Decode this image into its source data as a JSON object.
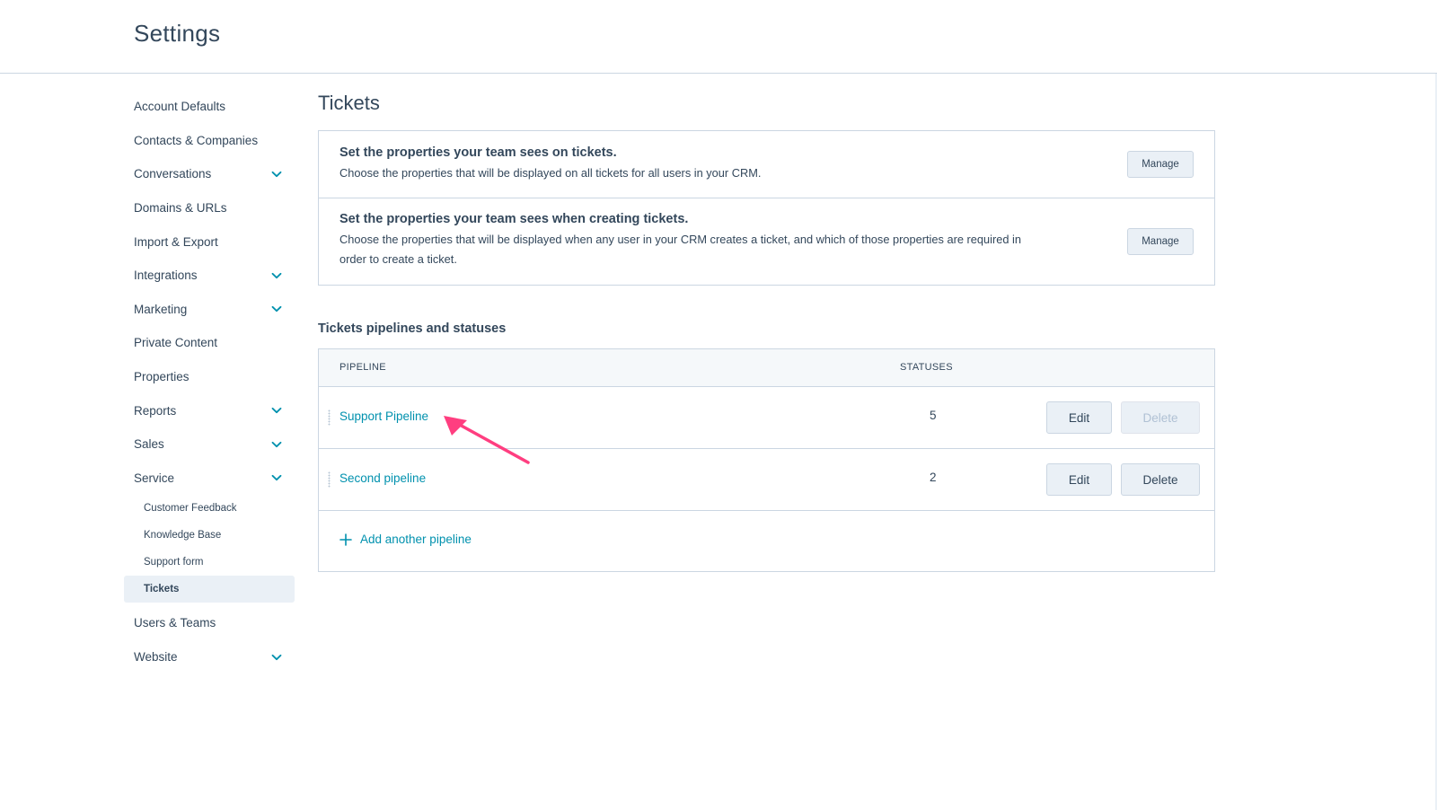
{
  "header": {
    "title": "Settings"
  },
  "sidebar": {
    "items": [
      {
        "label": "Account Defaults",
        "expandable": false
      },
      {
        "label": "Contacts & Companies",
        "expandable": false
      },
      {
        "label": "Conversations",
        "expandable": true
      },
      {
        "label": "Domains & URLs",
        "expandable": false
      },
      {
        "label": "Import & Export",
        "expandable": false
      },
      {
        "label": "Integrations",
        "expandable": true
      },
      {
        "label": "Marketing",
        "expandable": true
      },
      {
        "label": "Private Content",
        "expandable": false
      },
      {
        "label": "Properties",
        "expandable": false
      },
      {
        "label": "Reports",
        "expandable": true
      },
      {
        "label": "Sales",
        "expandable": true
      },
      {
        "label": "Service",
        "expandable": true
      }
    ],
    "service_subitems": [
      {
        "label": "Customer Feedback"
      },
      {
        "label": "Knowledge Base"
      },
      {
        "label": "Support form"
      },
      {
        "label": "Tickets",
        "active": true
      }
    ],
    "items_after": [
      {
        "label": "Users & Teams",
        "expandable": false
      },
      {
        "label": "Website",
        "expandable": true
      }
    ],
    "chevron_icon": "chevron-down-icon",
    "accent_color": "#0091ae"
  },
  "main": {
    "title": "Tickets",
    "properties": [
      {
        "heading": "Set the properties your team sees on tickets.",
        "description": "Choose the properties that will be displayed on all tickets for all users in your CRM.",
        "button": "Manage"
      },
      {
        "heading": "Set the properties your team sees when creating tickets.",
        "description": "Choose the properties that will be displayed when any user in your CRM creates a ticket, and which of those properties are required in order to create a ticket.",
        "button": "Manage"
      }
    ],
    "pipelines_title": "Tickets pipelines and statuses",
    "table": {
      "columns": [
        "PIPELINE",
        "STATUSES"
      ],
      "rows": [
        {
          "name": "Support Pipeline",
          "statuses": "5",
          "edit": "Edit",
          "delete": "Delete",
          "delete_disabled": true
        },
        {
          "name": "Second pipeline",
          "statuses": "2",
          "edit": "Edit",
          "delete": "Delete",
          "delete_disabled": false
        }
      ],
      "add_label": "Add another pipeline"
    }
  },
  "annotation": {
    "icon": "arrow-pointer-icon",
    "color": "#ff3e80"
  }
}
